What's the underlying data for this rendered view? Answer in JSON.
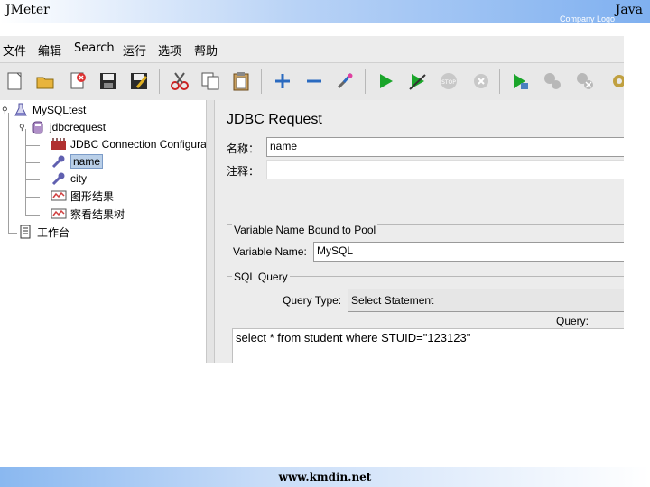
{
  "slide": {
    "title_left": "JMeter",
    "title_right": "Java",
    "company_logo": "Company Logo",
    "footer_url": "www.kmdin.net"
  },
  "menu": [
    "文件",
    "编辑",
    "Search",
    "运行",
    "选项",
    "帮助"
  ],
  "toolbar_icons": [
    "new-icon",
    "open-icon",
    "close-icon",
    "save-icon",
    "save-as-icon",
    "cut-icon",
    "copy-icon",
    "paste-icon",
    "expand-icon",
    "collapse-icon",
    "toggle-icon",
    "start-icon",
    "start-no-pause-icon",
    "stop-icon",
    "shutdown-icon",
    "remote-start-icon",
    "remote-stop-icon",
    "remote-shutdown-icon",
    "settings-icon"
  ],
  "tree": {
    "nodes": [
      {
        "label": "MySQLtest",
        "icon": "flask-icon"
      },
      {
        "label": "jdbcrequest",
        "icon": "thread-group-icon"
      },
      {
        "label": "JDBC Connection Configuration",
        "icon": "config-icon"
      },
      {
        "label": "name",
        "icon": "sampler-icon",
        "selected": true
      },
      {
        "label": "city",
        "icon": "sampler-icon"
      },
      {
        "label": "图形结果",
        "icon": "graph-icon"
      },
      {
        "label": "察看结果树",
        "icon": "graph-icon"
      },
      {
        "label": "工作台",
        "icon": "workbench-icon"
      }
    ]
  },
  "panel": {
    "title": "JDBC Request",
    "name_label": "名称：",
    "name_value": "name",
    "comment_label": "注释：",
    "comment_value": "",
    "pool_group_title": "Variable Name Bound to Pool",
    "pool_label": "Variable Name:",
    "pool_value": "MySQL",
    "sql_group_title": "SQL Query",
    "query_type_label": "Query Type:",
    "query_type_value": "Select Statement",
    "query_label": "Query:",
    "query_value": "select * from student where STUID=\"123123\""
  }
}
